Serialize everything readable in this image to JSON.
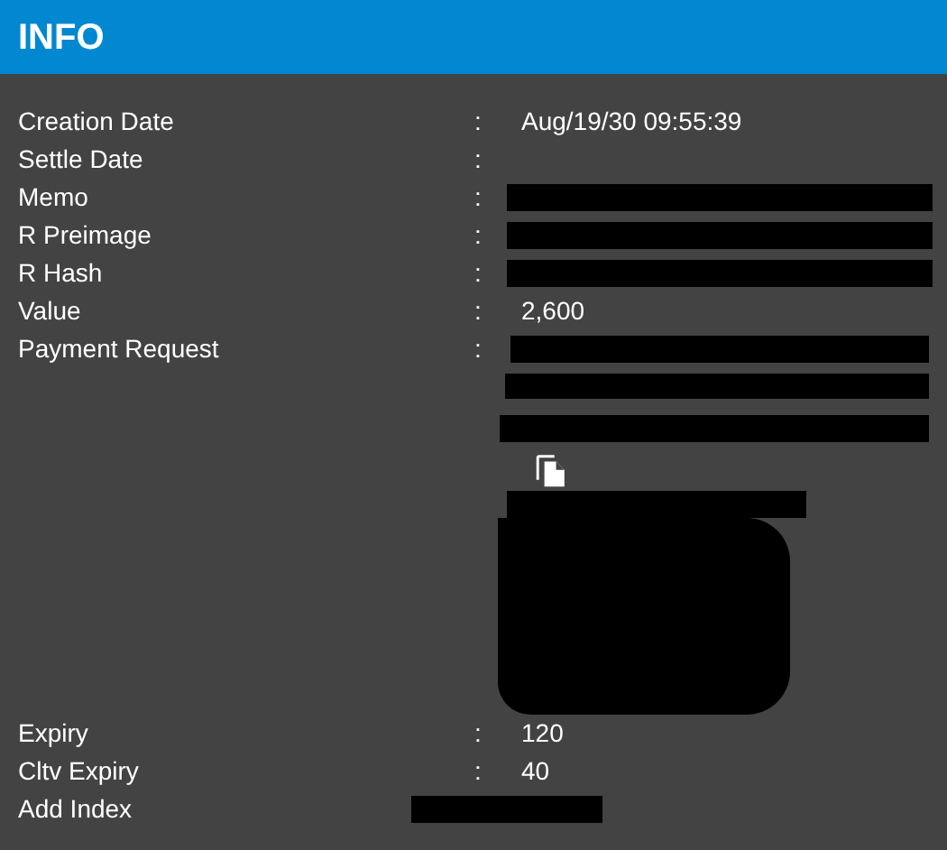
{
  "header": {
    "title": "INFO"
  },
  "rows": [
    {
      "kind": "text",
      "label": "Creation Date",
      "separator": ":",
      "value": "Aug/19/30 09:55:39"
    },
    {
      "kind": "text",
      "label": "Settle Date",
      "separator": ":"
    },
    {
      "kind": "redacted",
      "label": "Memo",
      "separator": ":"
    },
    {
      "kind": "redacted",
      "label": "R Preimage",
      "separator": ":"
    },
    {
      "kind": "redacted",
      "label": "R Hash",
      "separator": ":"
    },
    {
      "kind": "text",
      "label": "Value",
      "separator": ":",
      "value": "2,600"
    },
    {
      "kind": "payment_request",
      "label": "Payment Request",
      "separator": ":"
    },
    {
      "kind": "text",
      "label": "Expiry",
      "separator": ":",
      "value": "120"
    },
    {
      "kind": "text",
      "label": "Cltv Expiry",
      "separator": ":",
      "value": "40"
    },
    {
      "kind": "covered",
      "label": "Add Index"
    }
  ]
}
